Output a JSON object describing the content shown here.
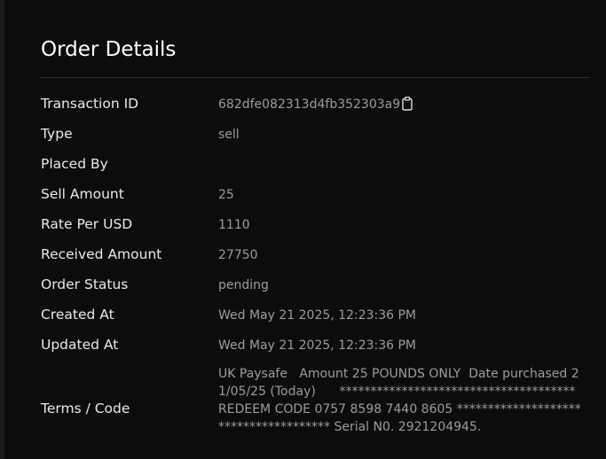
{
  "order": {
    "title": "Order Details",
    "fields": [
      {
        "label": "Transaction ID",
        "value": "682dfe082313d4fb352303a9"
      },
      {
        "label": "Type",
        "value": "sell"
      },
      {
        "label": "Placed By",
        "value": ""
      },
      {
        "label": "Sell Amount",
        "value": "25"
      },
      {
        "label": "Rate Per USD",
        "value": "1110"
      },
      {
        "label": "Received Amount",
        "value": "27750"
      },
      {
        "label": "Order Status",
        "value": "pending"
      },
      {
        "label": "Created At",
        "value": "Wed May 21 2025, 12:23:36 PM"
      },
      {
        "label": "Updated At",
        "value": "Wed May 21 2025, 12:23:36 PM"
      }
    ],
    "terms": {
      "label": "Terms / Code",
      "value": "UK Paysafe   Amount 25 POUNDS ONLY  Date purchased 21/05/25 (Today)      ************************************** REDEEM CODE 0757 8598 7440 8605 ************************************** Serial N0. 2921204945."
    },
    "copy_icon": "clipboard-icon"
  }
}
